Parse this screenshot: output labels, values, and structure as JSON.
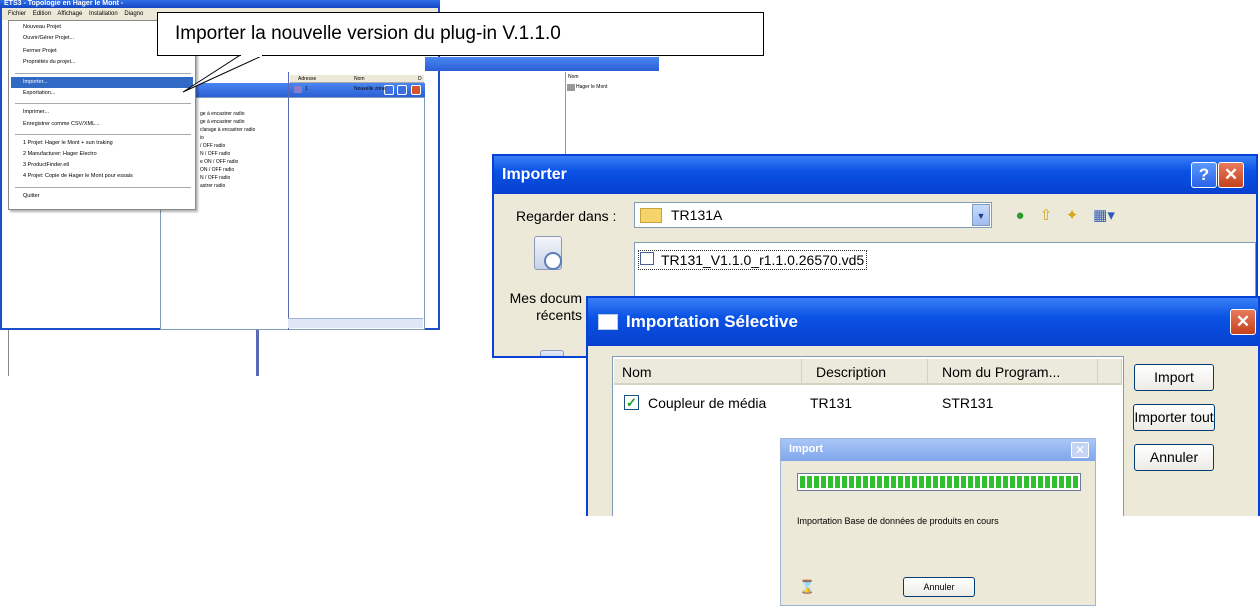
{
  "app": {
    "title": "ETS3 - Topologie en Hager le Mont -",
    "menubar": [
      "Fichier",
      "Edition",
      "Affichage",
      "Installation",
      "Diagno"
    ],
    "file_menu": [
      "Nouveau Projet",
      "Ouvrir/Gérer Projet...",
      "Fermer Projet",
      "Propriétés du projet...",
      "Importer...",
      "Exportation...",
      "Imprimer...",
      "Enregistrer comme CSV/XML...",
      "1 Projet: Hager le Mont + sun traking",
      "2 Manufacturer: Hager Electro",
      "3 ProductFinder.etl",
      "4 Projet: Copie de Hager le Mont pour essais",
      "Quitter"
    ],
    "background_list": [
      "ge à encastrer radio",
      "ge à encastrer radio",
      "clarage à encastrer radio",
      "io",
      "/ OFF radio",
      "N / OFF radio",
      "e ON / OFF radio",
      "ON / OFF radio",
      "N / OFF radio",
      "astrer radio"
    ],
    "table_headers": [
      "Adresse",
      "Nom",
      "D"
    ],
    "table_row": {
      "address": "1",
      "name": "Nouvelle zone"
    },
    "right_header": "Nom",
    "right_item": "Hager le Mont"
  },
  "callout": {
    "text": "Importer la nouvelle version du plug-in V.1.1.0"
  },
  "importer_dialog": {
    "title": "Importer",
    "help_symbol": "?",
    "close_symbol": "✕",
    "look_in_label": "Regarder dans :",
    "look_in_value": "TR131A",
    "places": [
      "Mes documents récents"
    ],
    "places_label_line1": "Mes docum",
    "places_label_line2": "récents",
    "file": "TR131_V1.1.0_r1.1.0.26570.vd5"
  },
  "selective_dialog": {
    "title": "Importation Sélective",
    "close_symbol": "✕",
    "columns": [
      "Nom",
      "Description",
      "Nom du Program..."
    ],
    "row": {
      "name": "Coupleur de média",
      "description": "TR131",
      "program": "STR131",
      "checked": true
    },
    "buttons": {
      "import": "Import",
      "import_all": "Importer tout",
      "cancel": "Annuler"
    }
  },
  "progress_dialog": {
    "title": "Import",
    "close_symbol": "✕",
    "progress": 1.0,
    "status": "Importation Base de données de produits en cours",
    "cancel": "Annuler",
    "hourglass": "⌛"
  },
  "colors": {
    "xp_title": "#0a52e4",
    "selection": "#316ac5",
    "progress_green": "#2fbf2f",
    "close_red": "#c5421b"
  }
}
